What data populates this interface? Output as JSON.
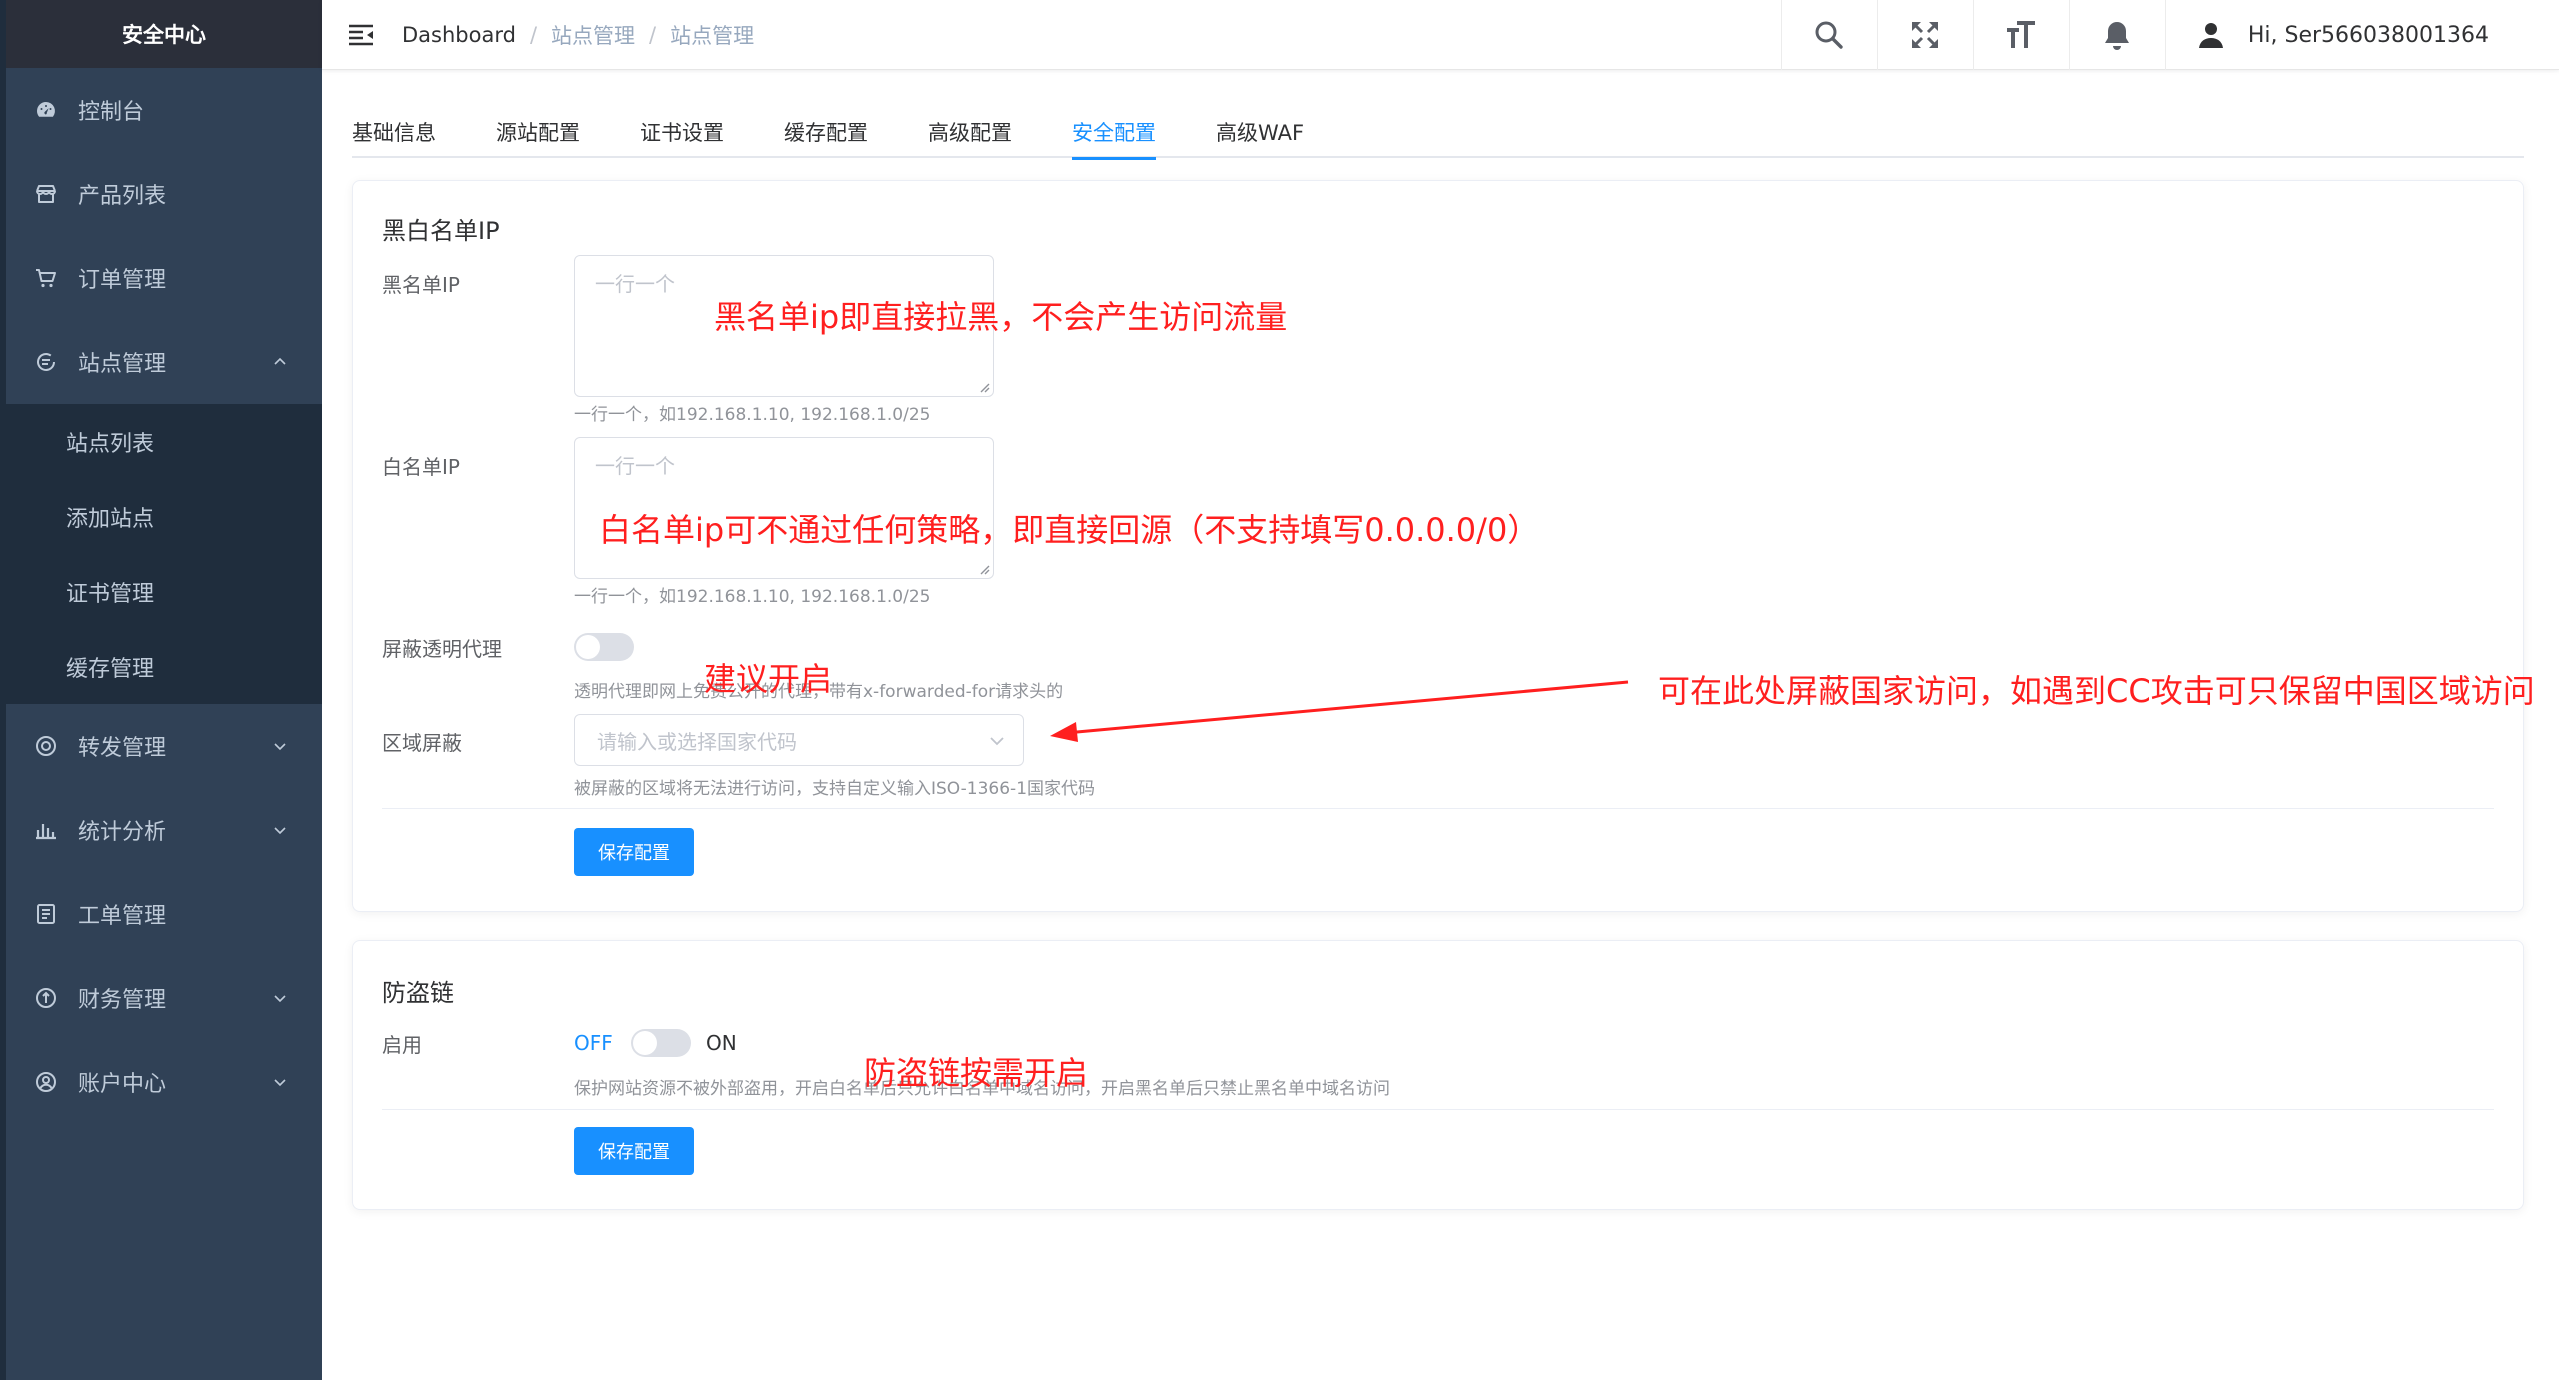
{
  "sidebar": {
    "title": "安全中心",
    "items": [
      {
        "label": "控制台",
        "icon": "dashboard-icon"
      },
      {
        "label": "产品列表",
        "icon": "store-icon"
      },
      {
        "label": "订单管理",
        "icon": "cart-icon"
      },
      {
        "label": "站点管理",
        "icon": "site-icon",
        "expanded": true
      },
      {
        "label": "转发管理",
        "icon": "forward-icon"
      },
      {
        "label": "统计分析",
        "icon": "chart-icon"
      },
      {
        "label": "工单管理",
        "icon": "ticket-icon"
      },
      {
        "label": "财务管理",
        "icon": "finance-icon"
      },
      {
        "label": "账户中心",
        "icon": "account-icon"
      }
    ],
    "submenu": [
      "站点列表",
      "添加站点",
      "证书管理",
      "缓存管理"
    ]
  },
  "header": {
    "breadcrumb": [
      "Dashboard",
      "站点管理",
      "站点管理"
    ],
    "user": "Hi, Ser566038001364"
  },
  "tabs": [
    "基础信息",
    "源站配置",
    "证书设置",
    "缓存配置",
    "高级配置",
    "安全配置",
    "高级WAF"
  ],
  "active_tab": "安全配置",
  "ip_section": {
    "title": "黑白名单IP",
    "blacklist_label": "黑名单IP",
    "blacklist_placeholder": "一行一个",
    "blacklist_hint": "一行一个，如192.168.1.10, 192.168.1.0/25",
    "whitelist_label": "白名单IP",
    "whitelist_placeholder": "一行一个",
    "whitelist_hint": "一行一个，如192.168.1.10, 192.168.1.0/25",
    "proxy_label": "屏蔽透明代理",
    "proxy_hint": "透明代理即网上免费公开的代理，带有x-forwarded-for请求头的",
    "region_label": "区域屏蔽",
    "region_placeholder": "请输入或选择国家代码",
    "region_hint": "被屏蔽的区域将无法进行访问，支持自定义输入ISO-1366-1国家代码",
    "save_label": "保存配置"
  },
  "hotlink_section": {
    "title": "防盗链",
    "enable_label": "启用",
    "off_label": "OFF",
    "on_label": "ON",
    "hint": "保护网站资源不被外部盗用，开启白名单后只允许白名单中域名访问，开启黑名单后只禁止黑名单中域名访问",
    "save_label": "保存配置"
  },
  "annotations": {
    "blacklist": "黑名单ip即直接拉黑，不会产生访问流量",
    "whitelist": "白名单ip可不通过任何策略，即直接回源（不支持填写0.0.0.0/0）",
    "proxy": "建议开启",
    "region": "可在此处屏蔽国家访问，如遇到CC攻击可只保留中国区域访问",
    "hotlink": "防盗链按需开启"
  },
  "colors": {
    "accent": "#1890ff",
    "sidebar_bg": "#304156",
    "annotation": "#ff1f1f"
  }
}
